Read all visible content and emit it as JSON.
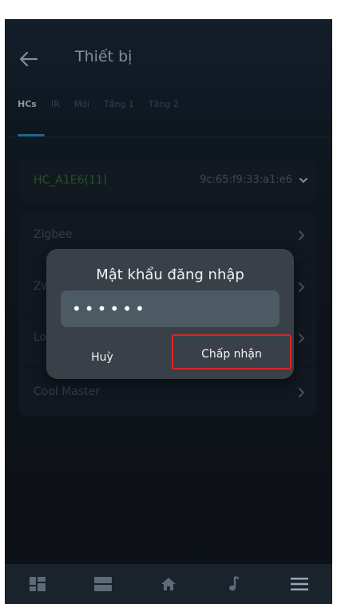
{
  "header": {
    "title": "Thiết bị"
  },
  "tabs": [
    {
      "label": "HCs",
      "active": true
    },
    {
      "label": "IR",
      "active": false
    },
    {
      "label": "Mới",
      "active": false
    },
    {
      "label": "Tầng 1",
      "active": false
    },
    {
      "label": "Tầng 2",
      "active": false
    }
  ],
  "hc": {
    "name": "HC_A1E6(11)",
    "mac": "9c:65:f9:33:a1:e6"
  },
  "list_items": [
    {
      "label": "Zigbee"
    },
    {
      "label": "Zwave"
    },
    {
      "label": "Lora"
    },
    {
      "label": "Cool Master"
    }
  ],
  "dialog": {
    "title": "Mật khẩu đăng nhập",
    "password_value": "••••••",
    "cancel_label": "Huỳ",
    "ok_label": "Chấp nhận"
  },
  "bottom_nav": [
    {
      "icon": "dashboard-icon"
    },
    {
      "icon": "list-view-icon"
    },
    {
      "icon": "home-icon"
    },
    {
      "icon": "music-note-icon"
    },
    {
      "icon": "menu-icon"
    }
  ],
  "colors": {
    "accent": "#2a9ad4",
    "hc_name": "#2f7d3a",
    "highlight_border": "#d9262b"
  }
}
